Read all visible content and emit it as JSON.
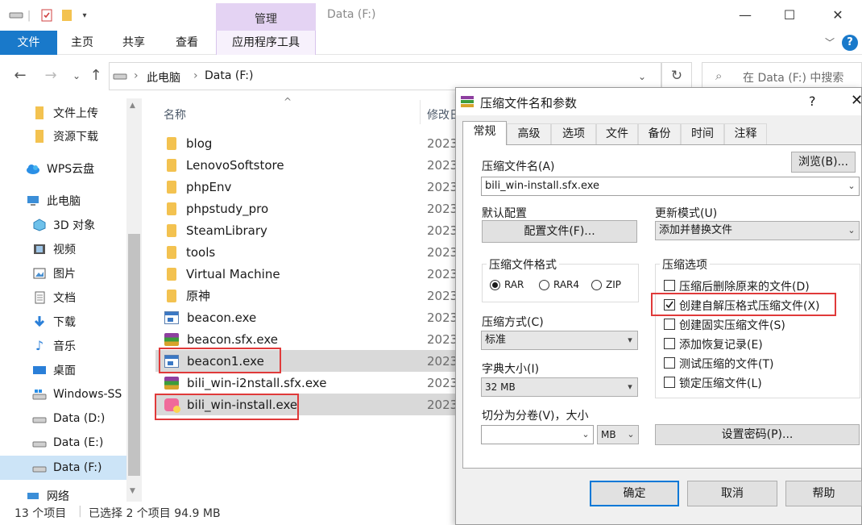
{
  "explorer": {
    "title": "Data (F:)",
    "context_tab": "管理",
    "ribbon": {
      "file": "文件",
      "tabs": [
        "主页",
        "共享",
        "查看"
      ],
      "app_tools": "应用程序工具"
    },
    "address": {
      "pc": "此电脑",
      "drive": "Data (F:)"
    },
    "search_placeholder": "在 Data (F:) 中搜索",
    "nav": [
      {
        "label": "文件上传",
        "icon": "folder-icon"
      },
      {
        "label": "资源下载",
        "icon": "folder-icon"
      },
      {
        "label": "WPS云盘",
        "icon": "cloud-icon"
      },
      {
        "label": "此电脑",
        "icon": "pc-icon"
      },
      {
        "label": "3D 对象",
        "icon": "3d-objects-icon"
      },
      {
        "label": "视频",
        "icon": "video-icon"
      },
      {
        "label": "图片",
        "icon": "pictures-icon"
      },
      {
        "label": "文档",
        "icon": "documents-icon"
      },
      {
        "label": "下载",
        "icon": "download-icon"
      },
      {
        "label": "音乐",
        "icon": "music-icon"
      },
      {
        "label": "桌面",
        "icon": "desktop-icon"
      },
      {
        "label": "Windows-SS",
        "icon": "drive-icon"
      },
      {
        "label": "Data (D:)",
        "icon": "drive-icon"
      },
      {
        "label": "Data (E:)",
        "icon": "drive-icon"
      },
      {
        "label": "Data (F:)",
        "icon": "drive-icon"
      },
      {
        "label": "网络",
        "icon": "network-icon"
      }
    ],
    "columns": {
      "name": "名称",
      "modified": "修改日"
    },
    "files": [
      {
        "name": "blog",
        "type": "folder",
        "date": "2023"
      },
      {
        "name": "LenovoSoftstore",
        "type": "folder",
        "date": "2023"
      },
      {
        "name": "phpEnv",
        "type": "folder",
        "date": "2023"
      },
      {
        "name": "phpstudy_pro",
        "type": "folder",
        "date": "2023"
      },
      {
        "name": "SteamLibrary",
        "type": "folder",
        "date": "2023"
      },
      {
        "name": "tools",
        "type": "folder",
        "date": "2023"
      },
      {
        "name": "Virtual Machine",
        "type": "folder",
        "date": "2023"
      },
      {
        "name": "原神",
        "type": "folder",
        "date": "2023"
      },
      {
        "name": "beacon.exe",
        "type": "exe",
        "date": "2023"
      },
      {
        "name": "beacon.sfx.exe",
        "type": "rar",
        "date": "2023"
      },
      {
        "name": "beacon1.exe",
        "type": "exe",
        "date": "2023"
      },
      {
        "name": "bili_win-i2nstall.sfx.exe",
        "type": "rar",
        "date": "2023"
      },
      {
        "name": "bili_win-install.exe",
        "type": "bili",
        "date": "2023"
      }
    ],
    "status": {
      "count": "13 个项目",
      "selected": "已选择 2 个项目  94.9 MB"
    }
  },
  "dialog": {
    "title": "压缩文件名和参数",
    "help": "?",
    "tabs": [
      "常规",
      "高级",
      "选项",
      "文件",
      "备份",
      "时间",
      "注释"
    ],
    "archive_name_label": "压缩文件名(A)",
    "browse": "浏览(B)...",
    "archive_name": "bili_win-install.sfx.exe",
    "default_profile_label": "默认配置",
    "profiles_btn": "配置文件(F)...",
    "update_mode_label": "更新模式(U)",
    "update_mode": "添加并替换文件",
    "format_label": "压缩文件格式",
    "formats": [
      "RAR",
      "RAR4",
      "ZIP"
    ],
    "method_label": "压缩方式(C)",
    "method": "标准",
    "dict_label": "字典大小(I)",
    "dict": "32 MB",
    "split_label": "切分为分卷(V)，大小",
    "split_unit": "MB",
    "options_label": "压缩选项",
    "options": [
      {
        "label": "压缩后删除原来的文件(D)",
        "checked": false
      },
      {
        "label": "创建自解压格式压缩文件(X)",
        "checked": true
      },
      {
        "label": "创建固实压缩文件(S)",
        "checked": false
      },
      {
        "label": "添加恢复记录(E)",
        "checked": false
      },
      {
        "label": "测试压缩的文件(T)",
        "checked": false
      },
      {
        "label": "锁定压缩文件(L)",
        "checked": false
      }
    ],
    "password_btn": "设置密码(P)...",
    "ok": "确定",
    "cancel": "取消",
    "helpbtn": "帮助"
  }
}
